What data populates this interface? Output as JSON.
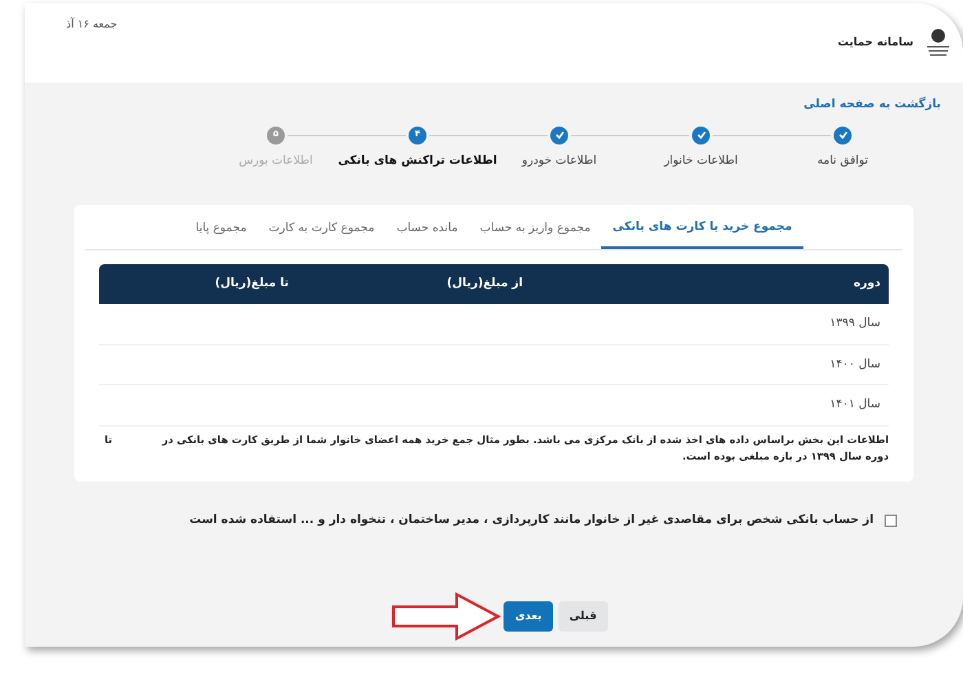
{
  "header": {
    "date": "جمعه ۱۶ آذ",
    "title": "سامانه حمایت"
  },
  "back_link": "بازگشت به صفحه اصلی",
  "steps": [
    {
      "label": "توافق نامه",
      "done": true,
      "current": false
    },
    {
      "label": "اطلاعات خانوار",
      "done": true,
      "current": false
    },
    {
      "label": "اطلاعات خودرو",
      "done": true,
      "current": false
    },
    {
      "label": "اطلاعات تراکنش های بانکی",
      "done": false,
      "current": true,
      "number": "۴"
    },
    {
      "label": "اطلاعات بورس",
      "done": false,
      "current": false,
      "number": "۵"
    }
  ],
  "tabs": [
    {
      "label": "مجموع خرید با کارت های بانکی",
      "selected": true
    },
    {
      "label": "مجموع واریز به حساب",
      "selected": false
    },
    {
      "label": "مانده حساب",
      "selected": false
    },
    {
      "label": "مجموع کارت به کارت",
      "selected": false
    },
    {
      "label": "مجموع پایا",
      "selected": false
    }
  ],
  "table": {
    "columns": [
      "دوره",
      "از مبلغ(ریال)",
      "تا مبلغ(ریال)"
    ],
    "rows": [
      {
        "period": "سال ۱۳۹۹"
      },
      {
        "period": "سال ۱۴۰۰"
      },
      {
        "period": "سال ۱۴۰۱"
      }
    ]
  },
  "note": "اطلاعات این بخش براساس داده های اخذ شده از بانک مرکزی می باشد. بطور مثال جمع خرید همه اعضای خانوار شما از طریق کارت های بانکی در دوره سال ۱۳۹۹ در بازه مبلغی بوده است.",
  "note_end": "تا",
  "checkbox": {
    "label": "از حساب بانکی شخص برای مقاصدی غیر از خانوار مانند کارپردازی ، مدیر ساختمان ، تنخواه دار و ... استفاده شده است",
    "checked": false
  },
  "buttons": [
    {
      "label": "قبلی",
      "kind": "secondary"
    },
    {
      "label": "بعدی",
      "kind": "primary"
    }
  ]
}
